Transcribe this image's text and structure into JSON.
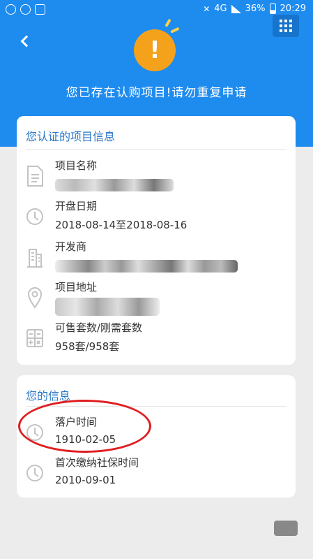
{
  "status_bar": {
    "battery": "36%",
    "time": "20:29",
    "network": "4G"
  },
  "header": {
    "message": "您已存在认购项目!请勿重复申请",
    "accent": "#1e8bef"
  },
  "project_card": {
    "title": "您认证的项目信息",
    "rows": [
      {
        "icon": "document-icon",
        "label": "项目名称",
        "value": ""
      },
      {
        "icon": "clock-icon",
        "label": "开盘日期",
        "value": "2018-08-14至2018-08-16"
      },
      {
        "icon": "building-icon",
        "label": "开发商",
        "value": ""
      },
      {
        "icon": "location-pin-icon",
        "label": "项目地址",
        "value": ""
      },
      {
        "icon": "calculator-icon",
        "label": "可售套数/刚需套数",
        "value": "958套/958套"
      }
    ]
  },
  "user_card": {
    "title": "您的信息",
    "rows": [
      {
        "icon": "clock-icon",
        "label": "落户时间",
        "value": "1910-02-05"
      },
      {
        "icon": "clock-icon",
        "label": "首次缴纳社保时间",
        "value": "2010-09-01"
      }
    ]
  }
}
